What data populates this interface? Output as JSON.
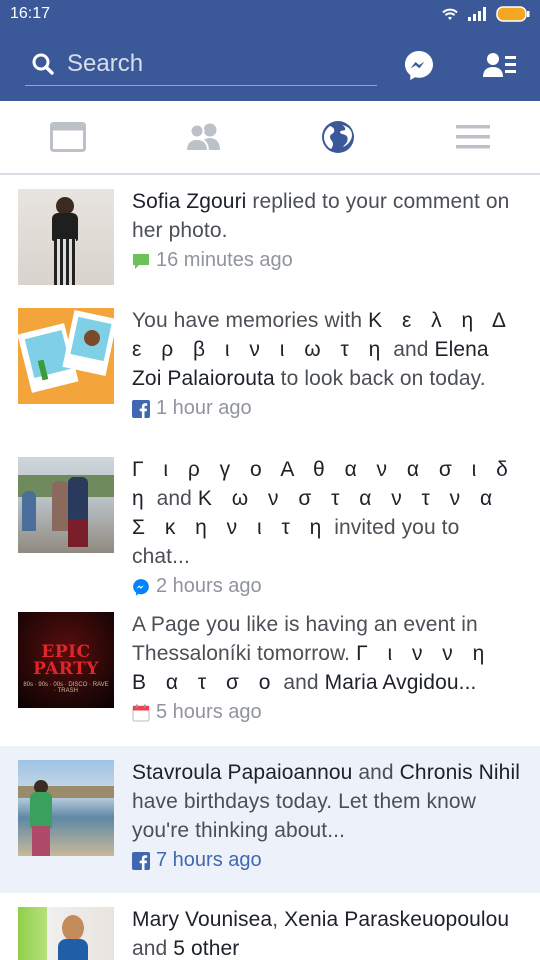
{
  "status": {
    "time": "16:17"
  },
  "search": {
    "placeholder": "Search"
  },
  "colors": {
    "brand": "#3b5998",
    "highlight": "#edf2fa",
    "active_tab": "#3b5998"
  },
  "tabs": [
    {
      "name": "news-feed",
      "icon": "news-feed-icon"
    },
    {
      "name": "friend-requests",
      "icon": "people-icon"
    },
    {
      "name": "notifications",
      "icon": "globe-icon",
      "active": true
    },
    {
      "name": "menu",
      "icon": "hamburger-icon"
    }
  ],
  "notifications": [
    {
      "name1": "Sofia Zgouri",
      "text1": " replied to your comment on her photo.",
      "time": "16 minutes ago",
      "icon": "comment-icon"
    },
    {
      "text0": "You have memories with ",
      "name1": "Κ ε λ η Δ ε ρ β ι ν ι ω τ η",
      "text1": " and ",
      "name2": "Elena Zoi Palaiorouta",
      "text2": " to look back on today.",
      "time": "1 hour ago",
      "icon": "facebook-icon"
    },
    {
      "name1": "Γ ι ρ γ ο Α θ α ν α σ ι δ η",
      "text1": " and ",
      "name2": "Κ ω ν σ τ α ν τ ν α Σ κ η ν ι τ η",
      "text2": " invited you to chat...",
      "time": "2 hours ago",
      "icon": "messenger-icon"
    },
    {
      "text0": "A Page you like is having an event in Thessaloníki tomorrow. ",
      "name1": "Γ ι ν ν η Β α τ σ ο",
      "text1": " and ",
      "name2": "Maria Avgidou...",
      "time": "5 hours ago",
      "icon": "calendar-icon",
      "thumb_title": "EPIC PARTY",
      "thumb_caption": "80s · 90s · 00s · DISCO · RAVE · TRASH"
    },
    {
      "name1": "Stavroula Papaioannou",
      "text1": " and ",
      "name2": "Chronis Nihil",
      "text2": " have birthdays today. Let them know you're thinking about...",
      "time": "7 hours ago",
      "icon": "facebook-icon",
      "unread": true
    },
    {
      "name1": "Mary Vounisea",
      "text1": ", ",
      "name2": "Xenia Paraskeuopoulou",
      "text2": " and ",
      "name3": "5 other"
    }
  ]
}
